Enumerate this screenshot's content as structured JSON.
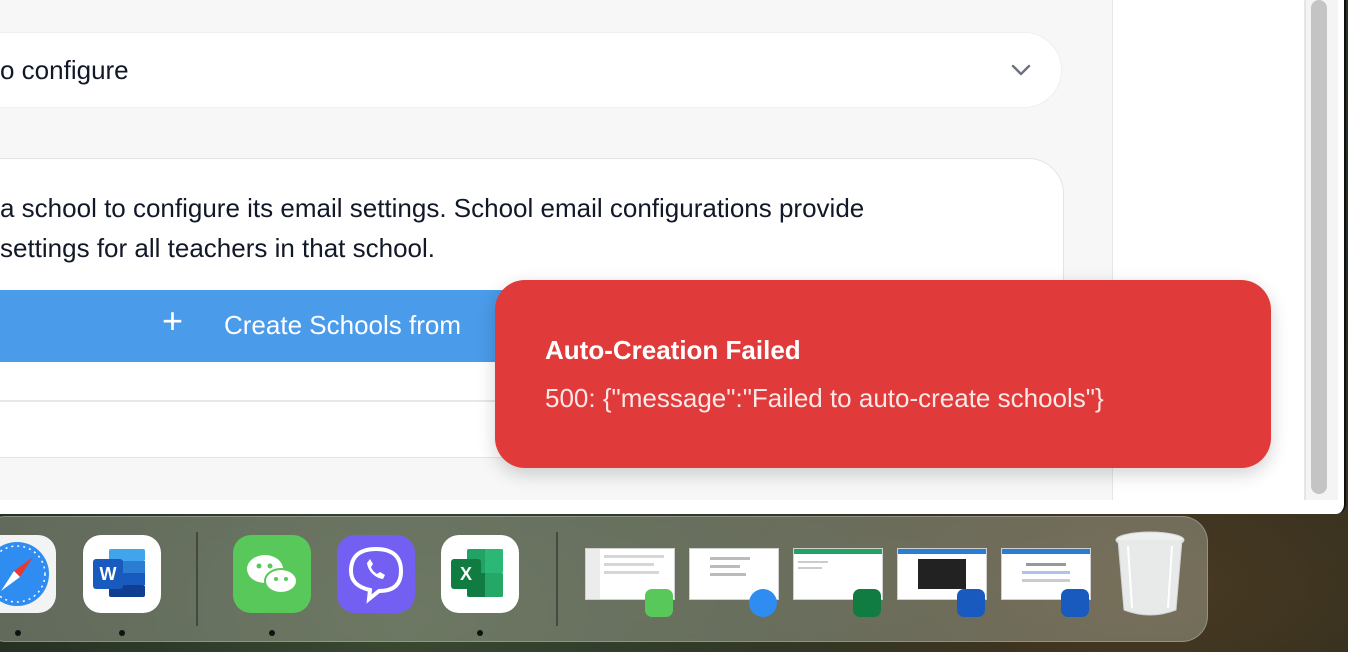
{
  "app": {
    "select": {
      "value": "o configure"
    },
    "card": {
      "description_line1": "a school to configure its email settings. School email configurations provide",
      "description_line2": "settings for all teachers in that school.",
      "create_button_label": "Create Schools from",
      "create_button_icon": "plus-icon"
    },
    "toast": {
      "title": "Auto-Creation Failed",
      "message": "500: {\"message\":\"Failed to auto-create schools\"}",
      "color": "#e03a3a"
    }
  },
  "colors": {
    "primary_button": "#4a9be9",
    "error_toast": "#e03a3a"
  },
  "dock": {
    "apps": [
      {
        "name": "Safari",
        "icon": "safari-icon",
        "running": true
      },
      {
        "name": "Microsoft Word",
        "icon": "word-icon",
        "running": true
      },
      {
        "name": "WeChat",
        "icon": "wechat-icon",
        "running": true
      },
      {
        "name": "Viber",
        "icon": "viber-icon",
        "running": false
      },
      {
        "name": "Microsoft Excel",
        "icon": "excel-icon",
        "running": true
      }
    ],
    "minimized_windows": [
      {
        "app": "WeChat",
        "badge": "wechat-icon"
      },
      {
        "app": "Safari",
        "badge": "safari-icon"
      },
      {
        "app": "Microsoft Excel",
        "badge": "excel-icon"
      },
      {
        "app": "Microsoft Word",
        "badge": "word-icon"
      },
      {
        "app": "Microsoft Word",
        "badge": "word-icon"
      }
    ],
    "trash": {
      "icon": "trash-icon"
    }
  }
}
